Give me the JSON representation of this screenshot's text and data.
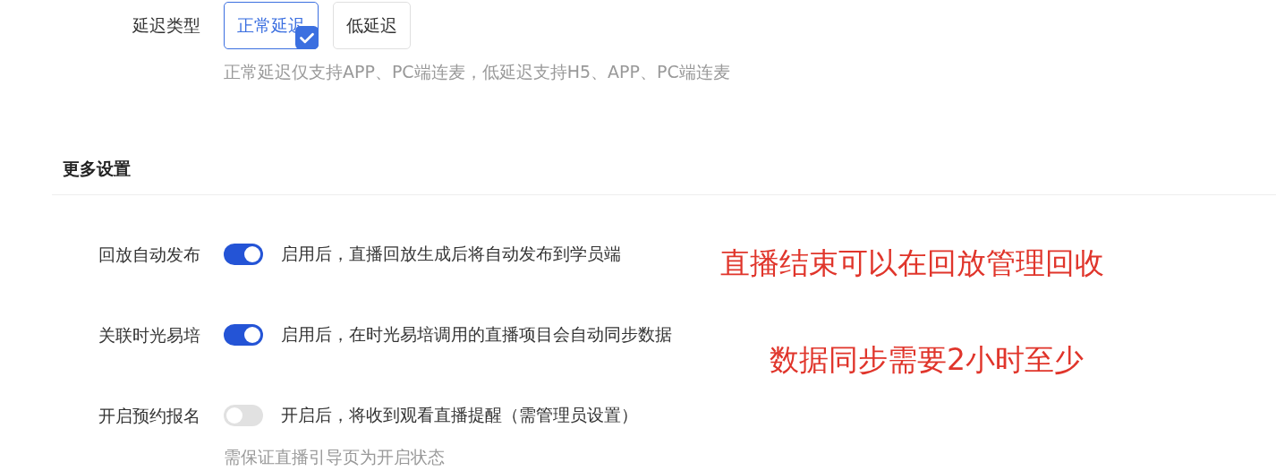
{
  "latency": {
    "label": "延迟类型",
    "options": [
      {
        "label": "正常延迟",
        "selected": true
      },
      {
        "label": "低延迟",
        "selected": false
      }
    ],
    "hint": "正常延迟仅支持APP、PC端连麦，低延迟支持H5、APP、PC端连麦"
  },
  "more_settings": {
    "title": "更多设置",
    "rows": [
      {
        "label": "回放自动发布",
        "on": true,
        "description": "启用后，直播回放生成后将自动发布到学员端"
      },
      {
        "label": "关联时光易培",
        "on": true,
        "description": "启用后，在时光易培调用的直播项目会自动同步数据"
      },
      {
        "label": "开启预约报名",
        "on": false,
        "description": "开启后，将收到观看直播提醒（需管理员设置）",
        "hint": "需保证直播引导页为开启状态"
      }
    ]
  },
  "annotations": [
    "直播结束可以在回放管理回收",
    "数据同步需要2小时至少"
  ]
}
